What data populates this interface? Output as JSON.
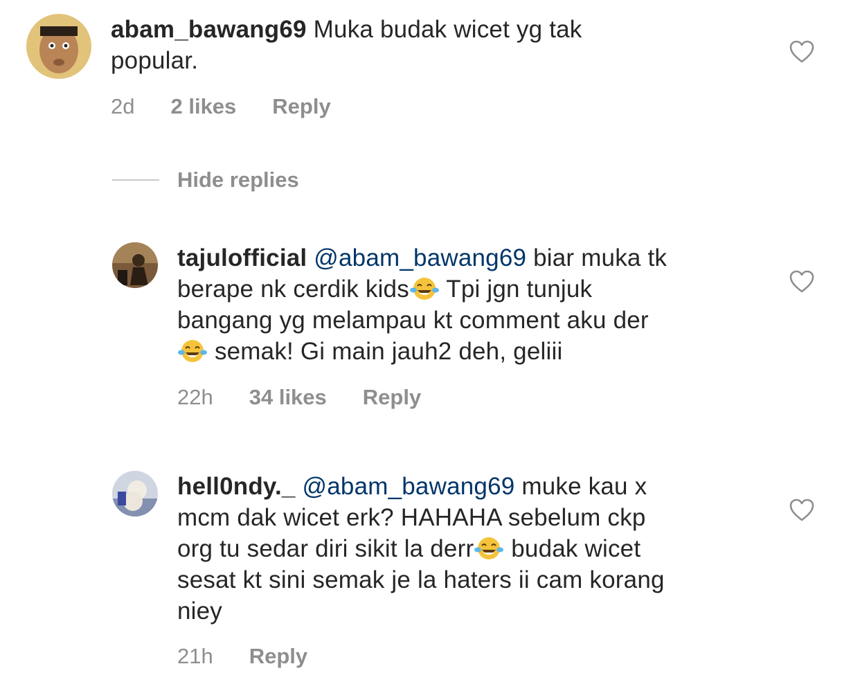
{
  "comments": [
    {
      "username": "abam_bawang69",
      "text_line1": "Muka budak wicet yg tak",
      "text_line2": "popular.",
      "time": "2d",
      "likes": "2 likes",
      "reply": "Reply"
    }
  ],
  "hide_replies": "Hide replies",
  "replies": [
    {
      "username": "tajulofficial",
      "mention": "@abam_bawang69",
      "line1_after": "biar muka tk",
      "line2_before": "berape nk cerdik kids",
      "line2_after": "Tpi jgn tunjuk",
      "line3": "bangang yg melampau kt comment aku der",
      "line4_after": "semak! Gi main jauh2 deh, geliii",
      "time": "22h",
      "likes": "34 likes",
      "reply": "Reply"
    },
    {
      "username": "hell0ndy._",
      "mention": "@abam_bawang69",
      "line1_after": "muke kau x",
      "line2": "mcm dak wicet erk? HAHAHA sebelum ckp",
      "line3_before": "org tu sedar diri sikit la derr",
      "line3_after": "budak wicet",
      "line4": "sesat kt sini semak je la haters ii cam korang",
      "line5": "niey",
      "time": "21h",
      "reply": "Reply"
    }
  ],
  "icons": {
    "like": "heart-outline-icon",
    "emoji": "face-with-tears-of-joy-icon"
  },
  "colors": {
    "text": "#262626",
    "meta": "#8e8e8e",
    "mention": "#003569"
  }
}
